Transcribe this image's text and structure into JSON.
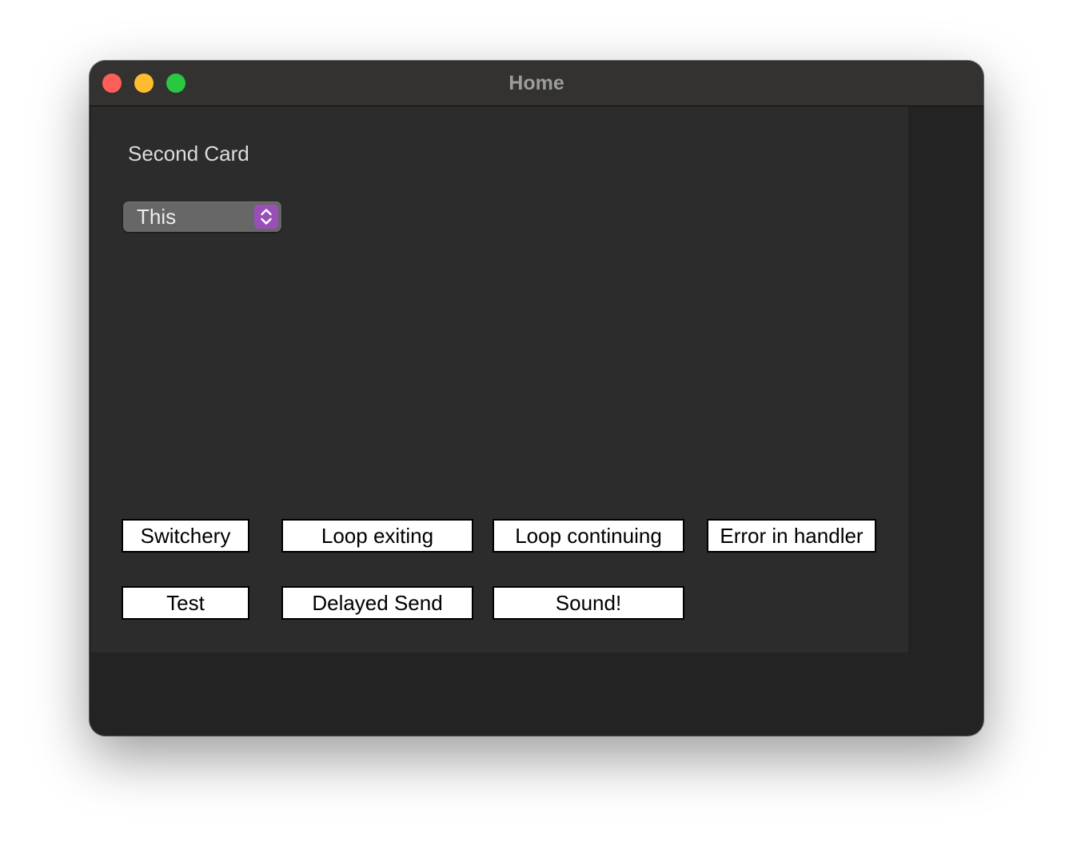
{
  "window": {
    "title": "Home"
  },
  "card": {
    "label": "Second Card",
    "popup": {
      "selected": "This"
    }
  },
  "buttons": {
    "switchery": "Switchery",
    "loop_exiting": "Loop exiting",
    "loop_continuing": "Loop continuing",
    "error_in_handler": "Error in handler",
    "test": "Test",
    "delayed_send": "Delayed Send",
    "sound": "Sound!"
  },
  "colors": {
    "close": "#fe5f57",
    "minimize": "#febc2e",
    "zoom": "#28c840",
    "popup_accent": "#9a4fb8"
  },
  "icons": {
    "popup_arrows": "chevron-up-down-icon"
  }
}
